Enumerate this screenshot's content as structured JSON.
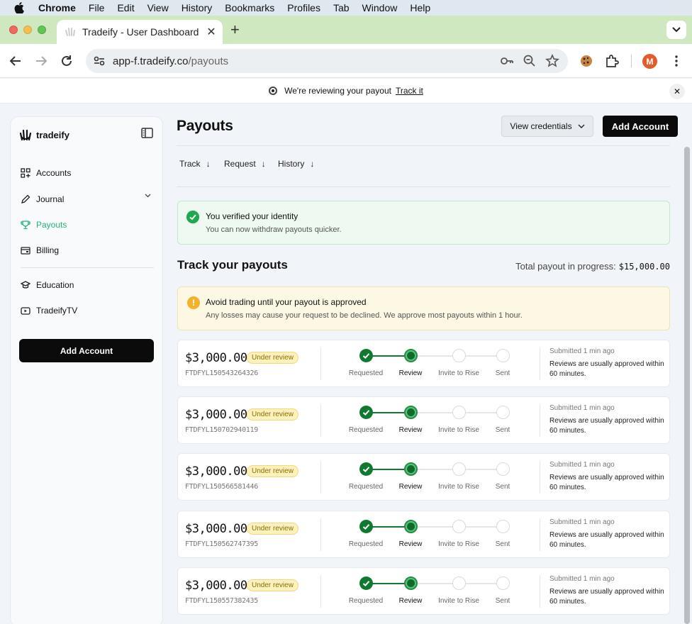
{
  "menubar": {
    "app": "Chrome",
    "items": [
      "File",
      "Edit",
      "View",
      "History",
      "Bookmarks",
      "Profiles",
      "Tab",
      "Window",
      "Help"
    ]
  },
  "browser": {
    "tab_title": "Tradeify - User Dashboard",
    "url_domain": "app-f.tradeify.co",
    "url_path": "/payouts",
    "avatar_letter": "M"
  },
  "banner": {
    "text": "We're reviewing your payout",
    "link": "Track it"
  },
  "sidebar": {
    "brand": "tradeify",
    "items": [
      {
        "label": "Accounts",
        "icon": "grid-icon"
      },
      {
        "label": "Journal",
        "icon": "pencil-icon"
      },
      {
        "label": "Payouts",
        "icon": "trophy-icon",
        "active": true
      },
      {
        "label": "Billing",
        "icon": "card-icon"
      },
      {
        "label": "Education",
        "icon": "graduation-cap-icon"
      },
      {
        "label": "TradeifyTV",
        "icon": "tv-icon"
      }
    ],
    "add_button": "Add Account"
  },
  "header": {
    "title": "Payouts",
    "view_credentials": "View credentials",
    "add_account": "Add Account"
  },
  "anchors": [
    "Track",
    "Request",
    "History"
  ],
  "verified": {
    "title": "You verified your identity",
    "subtitle": "You can now withdraw payouts quicker."
  },
  "track": {
    "title": "Track your payouts",
    "total_label": "Total payout in progress:",
    "total_amount": "$15,000.00"
  },
  "warning": {
    "title": "Avoid trading until your payout is approved",
    "subtitle": "Any losses may cause your request to be declined. We approve most payouts within 1 hour."
  },
  "step_labels": [
    "Requested",
    "Review",
    "Invite to Rise",
    "Sent"
  ],
  "payouts": [
    {
      "amount": "$3,000.00",
      "status": "Under review",
      "ref": "FTDFYL150543264326",
      "submitted": "Submitted 1 min ago",
      "note": "Reviews are usually approved within 60 minutes.",
      "current_step": 1
    },
    {
      "amount": "$3,000.00",
      "status": "Under review",
      "ref": "FTDFYL150702940119",
      "submitted": "Submitted 1 min ago",
      "note": "Reviews are usually approved within 60 minutes.",
      "current_step": 1
    },
    {
      "amount": "$3,000.00",
      "status": "Under review",
      "ref": "FTDFYL150566581446",
      "submitted": "Submitted 1 min ago",
      "note": "Reviews are usually approved within 60 minutes.",
      "current_step": 1
    },
    {
      "amount": "$3,000.00",
      "status": "Under review",
      "ref": "FTDFYL150562747395",
      "submitted": "Submitted 1 min ago",
      "note": "Reviews are usually approved within 60 minutes.",
      "current_step": 1
    },
    {
      "amount": "$3,000.00",
      "status": "Under review",
      "ref": "FTDFYL150557382435",
      "submitted": "Submitted 1 min ago",
      "note": "Reviews are usually approved within 60 minutes.",
      "current_step": 1
    }
  ],
  "colors": {
    "accent": "#22b573",
    "step_done": "#0f7a2f",
    "badge_bg": "#fdf2bd",
    "tabstrip": "#cfe8bf"
  }
}
